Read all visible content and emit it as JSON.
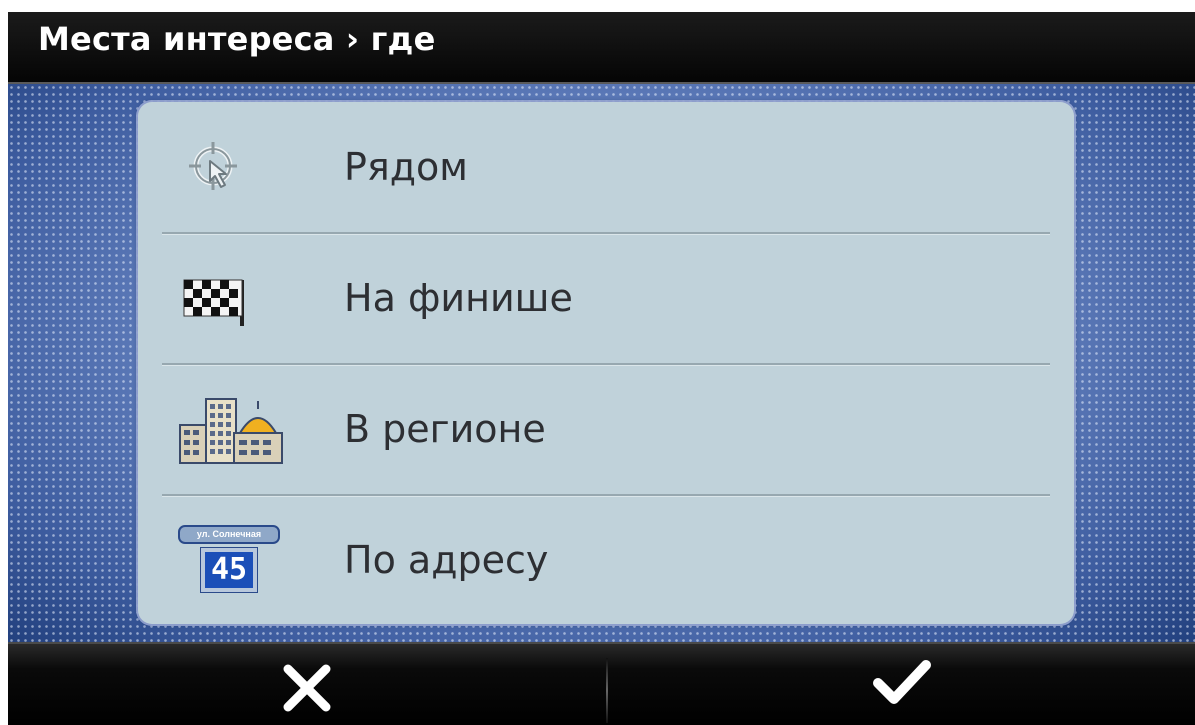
{
  "header": {
    "title": "Места интереса › где"
  },
  "menu": {
    "items": [
      {
        "label": "Рядом",
        "icon": "crosshair-cursor-icon"
      },
      {
        "label": "На финише",
        "icon": "checkered-flag-icon"
      },
      {
        "label": "В регионе",
        "icon": "city-buildings-icon"
      },
      {
        "label": "По адресу",
        "icon": "street-sign-icon",
        "sign_street": "ул. Солнечная",
        "sign_number": "45"
      }
    ]
  },
  "footer": {
    "cancel_icon": "close-icon",
    "confirm_icon": "checkmark-icon"
  },
  "colors": {
    "panel": "#c0d2da",
    "background": "#5878b8",
    "bar": "#000000",
    "text": "#2d2f33"
  }
}
